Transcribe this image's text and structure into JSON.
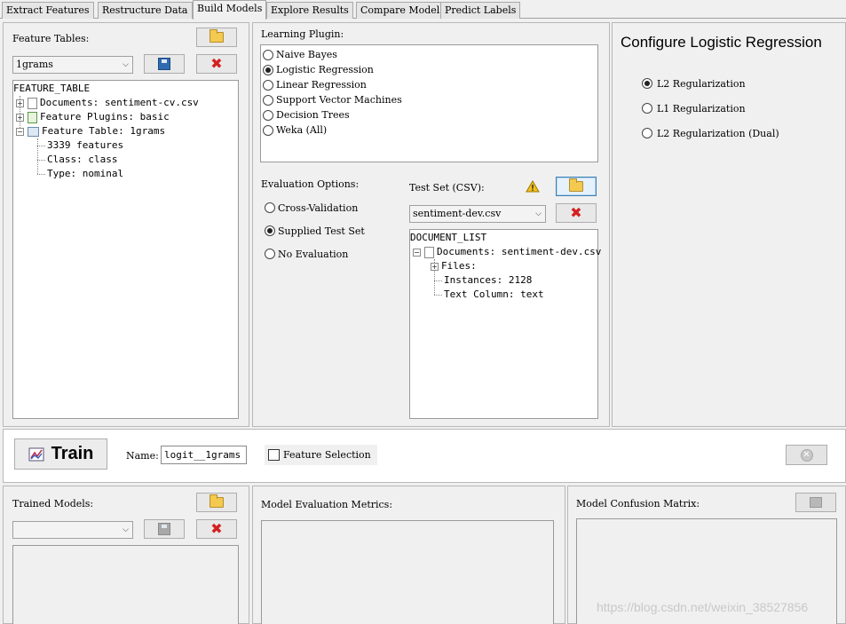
{
  "tabs": [
    "Extract Features",
    "Restructure Data",
    "Build Models",
    "Explore Results",
    "Compare Models",
    "Predict Labels"
  ],
  "active_tab": "Build Models",
  "feature_tables": {
    "label": "Feature Tables:",
    "selected": "1grams",
    "tree": {
      "root": "FEATURE_TABLE",
      "documents": "Documents: sentiment-cv.csv",
      "plugins": "Feature Plugins: basic",
      "table": "Feature Table: 1grams",
      "features": "3339 features",
      "class": "Class: class",
      "type": "Type: nominal"
    }
  },
  "learning_plugin": {
    "label": "Learning Plugin:",
    "options": [
      "Naive Bayes",
      "Logistic Regression",
      "Linear Regression",
      "Support Vector Machines",
      "Decision Trees",
      "Weka (All)"
    ],
    "selected": "Logistic Regression"
  },
  "evaluation": {
    "label": "Evaluation Options:",
    "options": [
      "Cross-Validation",
      "Supplied Test Set",
      "No Evaluation"
    ],
    "selected": "Supplied Test Set"
  },
  "test_set": {
    "label": "Test Set (CSV):",
    "selected": "sentiment-dev.csv",
    "tree": {
      "root": "DOCUMENT_LIST",
      "documents": "Documents: sentiment-dev.csv",
      "files": "Files:",
      "instances": "Instances: 2128",
      "text_column": "Text Column: text"
    }
  },
  "configure": {
    "title": "Configure Logistic Regression",
    "options": [
      "L2 Regularization",
      "L1 Regularization",
      "L2 Regularization (Dual)"
    ],
    "selected": "L2 Regularization"
  },
  "train": {
    "button": "Train",
    "name_label": "Name:",
    "name_value": "logit__1grams",
    "feature_selection": "Feature Selection"
  },
  "bottom": {
    "trained_models": "Trained Models:",
    "eval_metrics": "Model Evaluation Metrics:",
    "confusion": "Model Confusion Matrix:"
  },
  "watermark": "https://blog.csdn.net/weixin_38527856",
  "colors": {
    "accent_focus": "#3c7fb1",
    "delete_red": "#d42020",
    "warning": "#f0c020"
  }
}
